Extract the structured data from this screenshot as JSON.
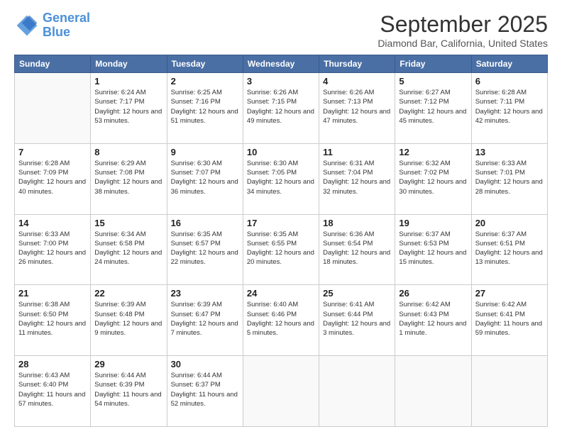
{
  "logo": {
    "line1": "General",
    "line2": "Blue"
  },
  "title": "September 2025",
  "location": "Diamond Bar, California, United States",
  "headers": [
    "Sunday",
    "Monday",
    "Tuesday",
    "Wednesday",
    "Thursday",
    "Friday",
    "Saturday"
  ],
  "rows": [
    [
      {
        "day": "",
        "sunrise": "",
        "sunset": "",
        "daylight": ""
      },
      {
        "day": "1",
        "sunrise": "Sunrise: 6:24 AM",
        "sunset": "Sunset: 7:17 PM",
        "daylight": "Daylight: 12 hours and 53 minutes."
      },
      {
        "day": "2",
        "sunrise": "Sunrise: 6:25 AM",
        "sunset": "Sunset: 7:16 PM",
        "daylight": "Daylight: 12 hours and 51 minutes."
      },
      {
        "day": "3",
        "sunrise": "Sunrise: 6:26 AM",
        "sunset": "Sunset: 7:15 PM",
        "daylight": "Daylight: 12 hours and 49 minutes."
      },
      {
        "day": "4",
        "sunrise": "Sunrise: 6:26 AM",
        "sunset": "Sunset: 7:13 PM",
        "daylight": "Daylight: 12 hours and 47 minutes."
      },
      {
        "day": "5",
        "sunrise": "Sunrise: 6:27 AM",
        "sunset": "Sunset: 7:12 PM",
        "daylight": "Daylight: 12 hours and 45 minutes."
      },
      {
        "day": "6",
        "sunrise": "Sunrise: 6:28 AM",
        "sunset": "Sunset: 7:11 PM",
        "daylight": "Daylight: 12 hours and 42 minutes."
      }
    ],
    [
      {
        "day": "7",
        "sunrise": "Sunrise: 6:28 AM",
        "sunset": "Sunset: 7:09 PM",
        "daylight": "Daylight: 12 hours and 40 minutes."
      },
      {
        "day": "8",
        "sunrise": "Sunrise: 6:29 AM",
        "sunset": "Sunset: 7:08 PM",
        "daylight": "Daylight: 12 hours and 38 minutes."
      },
      {
        "day": "9",
        "sunrise": "Sunrise: 6:30 AM",
        "sunset": "Sunset: 7:07 PM",
        "daylight": "Daylight: 12 hours and 36 minutes."
      },
      {
        "day": "10",
        "sunrise": "Sunrise: 6:30 AM",
        "sunset": "Sunset: 7:05 PM",
        "daylight": "Daylight: 12 hours and 34 minutes."
      },
      {
        "day": "11",
        "sunrise": "Sunrise: 6:31 AM",
        "sunset": "Sunset: 7:04 PM",
        "daylight": "Daylight: 12 hours and 32 minutes."
      },
      {
        "day": "12",
        "sunrise": "Sunrise: 6:32 AM",
        "sunset": "Sunset: 7:02 PM",
        "daylight": "Daylight: 12 hours and 30 minutes."
      },
      {
        "day": "13",
        "sunrise": "Sunrise: 6:33 AM",
        "sunset": "Sunset: 7:01 PM",
        "daylight": "Daylight: 12 hours and 28 minutes."
      }
    ],
    [
      {
        "day": "14",
        "sunrise": "Sunrise: 6:33 AM",
        "sunset": "Sunset: 7:00 PM",
        "daylight": "Daylight: 12 hours and 26 minutes."
      },
      {
        "day": "15",
        "sunrise": "Sunrise: 6:34 AM",
        "sunset": "Sunset: 6:58 PM",
        "daylight": "Daylight: 12 hours and 24 minutes."
      },
      {
        "day": "16",
        "sunrise": "Sunrise: 6:35 AM",
        "sunset": "Sunset: 6:57 PM",
        "daylight": "Daylight: 12 hours and 22 minutes."
      },
      {
        "day": "17",
        "sunrise": "Sunrise: 6:35 AM",
        "sunset": "Sunset: 6:55 PM",
        "daylight": "Daylight: 12 hours and 20 minutes."
      },
      {
        "day": "18",
        "sunrise": "Sunrise: 6:36 AM",
        "sunset": "Sunset: 6:54 PM",
        "daylight": "Daylight: 12 hours and 18 minutes."
      },
      {
        "day": "19",
        "sunrise": "Sunrise: 6:37 AM",
        "sunset": "Sunset: 6:53 PM",
        "daylight": "Daylight: 12 hours and 15 minutes."
      },
      {
        "day": "20",
        "sunrise": "Sunrise: 6:37 AM",
        "sunset": "Sunset: 6:51 PM",
        "daylight": "Daylight: 12 hours and 13 minutes."
      }
    ],
    [
      {
        "day": "21",
        "sunrise": "Sunrise: 6:38 AM",
        "sunset": "Sunset: 6:50 PM",
        "daylight": "Daylight: 12 hours and 11 minutes."
      },
      {
        "day": "22",
        "sunrise": "Sunrise: 6:39 AM",
        "sunset": "Sunset: 6:48 PM",
        "daylight": "Daylight: 12 hours and 9 minutes."
      },
      {
        "day": "23",
        "sunrise": "Sunrise: 6:39 AM",
        "sunset": "Sunset: 6:47 PM",
        "daylight": "Daylight: 12 hours and 7 minutes."
      },
      {
        "day": "24",
        "sunrise": "Sunrise: 6:40 AM",
        "sunset": "Sunset: 6:46 PM",
        "daylight": "Daylight: 12 hours and 5 minutes."
      },
      {
        "day": "25",
        "sunrise": "Sunrise: 6:41 AM",
        "sunset": "Sunset: 6:44 PM",
        "daylight": "Daylight: 12 hours and 3 minutes."
      },
      {
        "day": "26",
        "sunrise": "Sunrise: 6:42 AM",
        "sunset": "Sunset: 6:43 PM",
        "daylight": "Daylight: 12 hours and 1 minute."
      },
      {
        "day": "27",
        "sunrise": "Sunrise: 6:42 AM",
        "sunset": "Sunset: 6:41 PM",
        "daylight": "Daylight: 11 hours and 59 minutes."
      }
    ],
    [
      {
        "day": "28",
        "sunrise": "Sunrise: 6:43 AM",
        "sunset": "Sunset: 6:40 PM",
        "daylight": "Daylight: 11 hours and 57 minutes."
      },
      {
        "day": "29",
        "sunrise": "Sunrise: 6:44 AM",
        "sunset": "Sunset: 6:39 PM",
        "daylight": "Daylight: 11 hours and 54 minutes."
      },
      {
        "day": "30",
        "sunrise": "Sunrise: 6:44 AM",
        "sunset": "Sunset: 6:37 PM",
        "daylight": "Daylight: 11 hours and 52 minutes."
      },
      {
        "day": "",
        "sunrise": "",
        "sunset": "",
        "daylight": ""
      },
      {
        "day": "",
        "sunrise": "",
        "sunset": "",
        "daylight": ""
      },
      {
        "day": "",
        "sunrise": "",
        "sunset": "",
        "daylight": ""
      },
      {
        "day": "",
        "sunrise": "",
        "sunset": "",
        "daylight": ""
      }
    ]
  ]
}
